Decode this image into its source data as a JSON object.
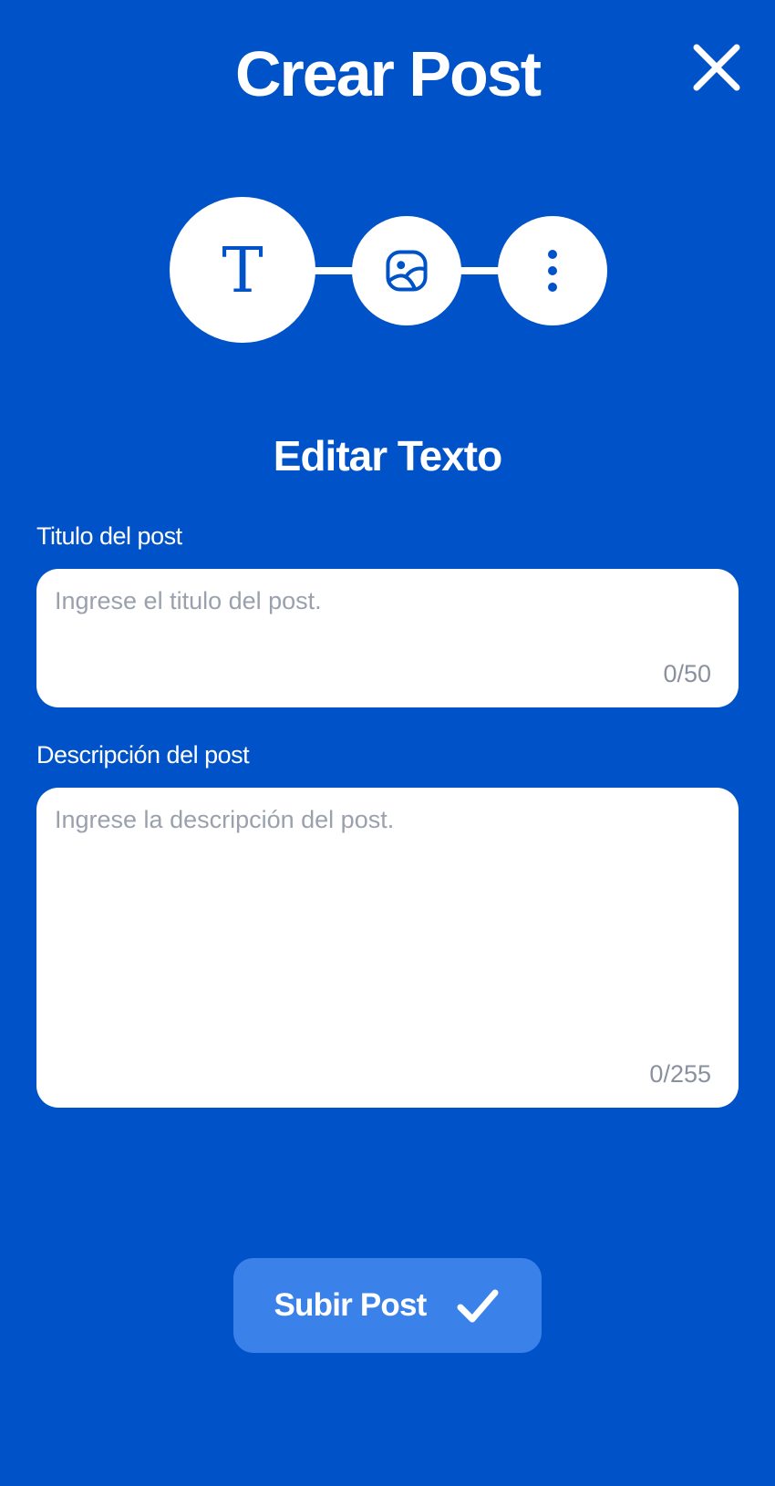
{
  "header": {
    "title": "Crear Post",
    "close_icon": "close-icon"
  },
  "steps": [
    {
      "name": "text",
      "glyph": "T",
      "active": true
    },
    {
      "name": "image",
      "icon": "image-icon",
      "active": false
    },
    {
      "name": "more",
      "icon": "more-vertical-icon",
      "active": false
    }
  ],
  "section": {
    "title": "Editar Texto"
  },
  "form": {
    "title_field": {
      "label": "Titulo del post",
      "placeholder": "Ingrese el titulo del post.",
      "value": "",
      "counter": "0/50"
    },
    "description_field": {
      "label": "Descripción del post",
      "placeholder": "Ingrese la descripción del post.",
      "value": "",
      "counter": "0/255"
    }
  },
  "submit": {
    "label": "Subir Post",
    "icon": "check-icon"
  },
  "colors": {
    "background": "#0052C8",
    "button": "#3A82EA",
    "placeholder": "#9AA1AD"
  }
}
